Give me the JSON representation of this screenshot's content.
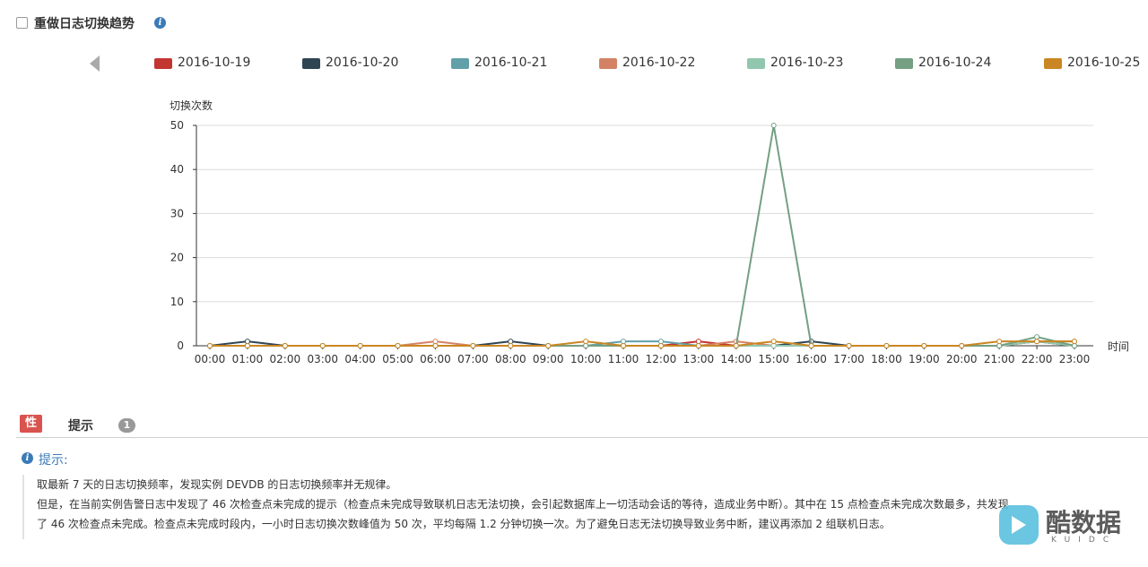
{
  "header": {
    "title": "重做日志切换趋势",
    "checkbox_checked": false,
    "info_icon": "info-icon"
  },
  "legend": {
    "prev_icon": "triangle-left-icon",
    "items": [
      {
        "label": "2016-10-19",
        "color": "#c23531"
      },
      {
        "label": "2016-10-20",
        "color": "#2f4554"
      },
      {
        "label": "2016-10-21",
        "color": "#61a0a8"
      },
      {
        "label": "2016-10-22",
        "color": "#d48265"
      },
      {
        "label": "2016-10-23",
        "color": "#91c7ae"
      },
      {
        "label": "2016-10-24",
        "color": "#749f83"
      },
      {
        "label": "2016-10-25",
        "color": "#ca8622"
      }
    ]
  },
  "chart_data": {
    "type": "line",
    "ylabel": "切换次数",
    "xlabel": "时间",
    "ylim": [
      0,
      50
    ],
    "yticks": [
      0,
      10,
      20,
      30,
      40,
      50
    ],
    "grid": true,
    "legend_position": "top",
    "categories": [
      "00:00",
      "01:00",
      "02:00",
      "03:00",
      "04:00",
      "05:00",
      "06:00",
      "07:00",
      "08:00",
      "09:00",
      "10:00",
      "11:00",
      "12:00",
      "13:00",
      "14:00",
      "15:00",
      "16:00",
      "17:00",
      "18:00",
      "19:00",
      "20:00",
      "21:00",
      "22:00",
      "23:00"
    ],
    "series": [
      {
        "name": "2016-10-19",
        "color": "#c23531",
        "values": [
          0,
          0,
          0,
          0,
          0,
          0,
          0,
          0,
          0,
          0,
          0,
          0,
          0,
          1,
          0,
          0,
          0,
          0,
          0,
          0,
          0,
          0,
          1,
          0
        ]
      },
      {
        "name": "2016-10-20",
        "color": "#2f4554",
        "values": [
          0,
          1,
          0,
          0,
          0,
          0,
          0,
          0,
          1,
          0,
          0,
          0,
          0,
          0,
          0,
          0,
          1,
          0,
          0,
          0,
          0,
          0,
          1,
          0
        ]
      },
      {
        "name": "2016-10-21",
        "color": "#61a0a8",
        "values": [
          0,
          0,
          0,
          0,
          0,
          0,
          0,
          0,
          0,
          0,
          0,
          1,
          1,
          0,
          0,
          0,
          0,
          0,
          0,
          0,
          0,
          0,
          1,
          0
        ]
      },
      {
        "name": "2016-10-22",
        "color": "#d48265",
        "values": [
          0,
          0,
          0,
          0,
          0,
          0,
          1,
          0,
          0,
          0,
          0,
          0,
          0,
          0,
          1,
          0,
          0,
          0,
          0,
          0,
          0,
          0,
          1,
          1
        ]
      },
      {
        "name": "2016-10-23",
        "color": "#91c7ae",
        "values": [
          0,
          0,
          0,
          0,
          0,
          0,
          0,
          0,
          0,
          0,
          0,
          0,
          0,
          0,
          0,
          0,
          0,
          0,
          0,
          0,
          0,
          0,
          1,
          0
        ]
      },
      {
        "name": "2016-10-24",
        "color": "#749f83",
        "values": [
          0,
          0,
          0,
          0,
          0,
          0,
          0,
          0,
          0,
          0,
          0,
          0,
          0,
          0,
          0,
          50,
          0,
          0,
          0,
          0,
          0,
          0,
          2,
          0
        ]
      },
      {
        "name": "2016-10-25",
        "color": "#ca8622",
        "values": [
          0,
          0,
          0,
          0,
          0,
          0,
          0,
          0,
          0,
          0,
          1,
          0,
          0,
          0,
          0,
          1,
          0,
          0,
          0,
          0,
          0,
          1,
          1,
          1
        ]
      }
    ]
  },
  "tabs": {
    "performance_label": "性能",
    "tips_label": "提示",
    "tips_count": "1"
  },
  "tip": {
    "title": "提示:",
    "lines": [
      "取最新 7 天的日志切换频率，发现实例 DEVDB 的日志切换频率并无规律。",
      "但是，在当前实例告警日志中发现了 46 次检查点未完成的提示（检查点未完成导致联机日志无法切换，会引起数据库上一切活动会话的等待，造成业务中断）。其中在 15 点检查点未完成次数最多，共发现",
      "了 46 次检查点未完成。检查点未完成时段内，一小时日志切换次数峰值为 50 次，平均每隔 1.2 分钟切换一次。为了避免日志无法切换导致业务中断，建议再添加 2 组联机日志。"
    ]
  },
  "watermark": {
    "text": "酷数据",
    "sub": "KUIDC"
  }
}
